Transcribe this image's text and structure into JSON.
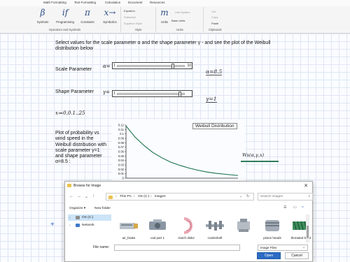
{
  "ribbon": {
    "tabs": [
      "",
      "Math Formatting",
      "Text Formatting",
      "Calculation",
      "Document",
      "Resources"
    ],
    "buttons": [
      {
        "glyph": "β",
        "label": "Symbols"
      },
      {
        "glyph": "if",
        "label": "Programming"
      },
      {
        "glyph": "π",
        "label": "Constants"
      },
      {
        "glyph": "x→",
        "label": "Symbolics"
      }
    ],
    "groups": [
      "Operators and Symbols",
      "Style",
      "Units",
      "Clipboard"
    ],
    "style_options": [
      "Equation",
      "Subscript",
      "Equation Style"
    ],
    "units": {
      "glyph": "m",
      "label": "Units",
      "base": "Base Units",
      "extra": "Unit System"
    },
    "clipboard": [
      "Cut",
      "Copy",
      "Paste"
    ]
  },
  "worksheet": {
    "intro_line1": "Select values for the scale parameter α and the shape parameter γ - and see the plot of the Weibull",
    "intro_line2": "distribution below",
    "scale_label": "Scale Parameter",
    "shape_label": "Shape Parameter",
    "alpha_var": "α=",
    "gamma_var": "γ=",
    "alpha_slider": {
      "min": "1",
      "max": "10",
      "value": 8.5
    },
    "gamma_slider": {
      "min": "1",
      "max": "",
      "value": 1
    },
    "alpha_result": "α=8.5",
    "gamma_result": "γ=1",
    "range_def": "x≔0,0.1‥25",
    "desc_lines": [
      "Plot of probability vs",
      "wind speed in the",
      "Weibull distribution with",
      "scale parameter γ=1",
      "and shape parameter",
      "α=8.5  :"
    ],
    "plus_glyph": "+"
  },
  "chart_data": {
    "type": "line",
    "title": "Weibull Distribution",
    "series": [
      {
        "name": "Ws(α,γ,x)",
        "color": "#2e7d5b",
        "x": [
          0,
          2,
          4,
          6,
          8,
          10,
          12,
          14,
          16,
          18,
          20,
          22,
          25
        ],
        "y": [
          0.118,
          0.093,
          0.074,
          0.058,
          0.046,
          0.036,
          0.029,
          0.023,
          0.018,
          0.014,
          0.011,
          0.009,
          0.006
        ]
      }
    ],
    "ylim": [
      0,
      0.12
    ],
    "xlim": [
      0,
      25
    ],
    "yticks": [
      "0.12",
      "0.11",
      "0.1",
      "0.09",
      "0.08",
      "0.07",
      "0.06",
      "0.05",
      "0.04",
      "0.03",
      "0.02",
      "0.01",
      "0"
    ],
    "grid": false,
    "legend": "right"
  },
  "dialog": {
    "title": "Browse for Image",
    "close": "✕",
    "path": [
      "This PC",
      "OS (C:)",
      "images"
    ],
    "search_placeholder": "Search images",
    "organize": "Organize ▾",
    "new_folder": "New folder",
    "nav_items": [
      {
        "label": "OS (C:)",
        "icon": "drive-icon"
      },
      {
        "label": "Network",
        "icon": "network-icon"
      }
    ],
    "files": [
      "air_brake",
      "cad part 1",
      "clutch disk2",
      "crankshaft",
      "",
      "piston head2",
      "threaded bolt2"
    ],
    "filename_label": "File name:",
    "filename_value": "",
    "filter": "Image Files",
    "open": "Open",
    "cancel": "Cancel"
  }
}
